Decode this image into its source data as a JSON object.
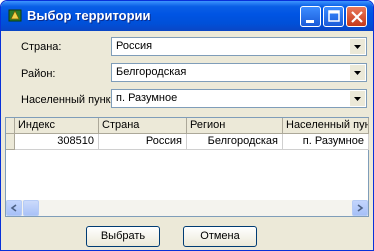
{
  "window": {
    "title": "Выбор территории",
    "icon": "app-icon",
    "controls": [
      "minimize-icon",
      "maximize-icon",
      "close-icon"
    ]
  },
  "form": {
    "country_label": "Страна:",
    "country_value": "Россия",
    "district_label": "Район:",
    "district_value": "Белгородская",
    "locality_label": "Населенный пункт:",
    "locality_value": "п. Разумное"
  },
  "table": {
    "columns": [
      "Индекс",
      "Страна",
      "Регион",
      "Населенный пункт"
    ],
    "rows": [
      [
        "308510",
        "Россия",
        "Белгородская",
        "п. Разумное"
      ]
    ]
  },
  "buttons": {
    "select": "Выбрать",
    "cancel": "Отмена"
  },
  "colors": {
    "titlebar": "#0054e3",
    "window_bg": "#ece9d8",
    "close_button": "#c5391a"
  }
}
